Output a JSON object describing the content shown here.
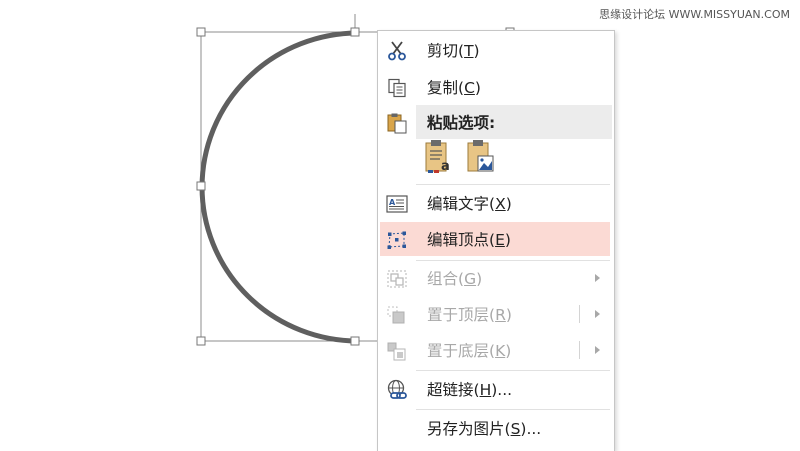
{
  "watermark": "思缘设计论坛 WWW.MISSYUAN.COM",
  "menu": {
    "items": [
      {
        "label_pre": "剪切(",
        "key": "T",
        "label_post": ")",
        "icon": "scissors-icon",
        "disabled": false
      },
      {
        "label_pre": "复制(",
        "key": "C",
        "label_post": ")",
        "icon": "copy-icon",
        "disabled": false
      },
      {
        "label": "粘贴选项:",
        "icon": "paste-icon"
      },
      {
        "label_pre": "编辑文字(",
        "key": "X",
        "label_post": ")",
        "icon": "edit-text-icon",
        "disabled": false
      },
      {
        "label_pre": "编辑顶点(",
        "key": "E",
        "label_post": ")",
        "icon": "edit-points-icon",
        "disabled": false,
        "highlighted": true
      },
      {
        "label_pre": "组合(",
        "key": "G",
        "label_post": ")",
        "icon": "group-icon",
        "disabled": true,
        "submenu": true
      },
      {
        "label_pre": "置于顶层(",
        "key": "R",
        "label_post": ")",
        "icon": "bring-to-front-icon",
        "disabled": true,
        "submenu": true
      },
      {
        "label_pre": "置于底层(",
        "key": "K",
        "label_post": ")",
        "icon": "send-to-back-icon",
        "disabled": true,
        "submenu": true
      },
      {
        "label_pre": "超链接(",
        "key": "H",
        "label_post": ")...",
        "icon": "hyperlink-icon",
        "disabled": false
      },
      {
        "label_pre": "另存为图片(",
        "key": "S",
        "label_post": ")...",
        "icon": "",
        "disabled": false
      }
    ],
    "paste_options": [
      "paste-keep-text-icon",
      "paste-as-picture-icon"
    ]
  },
  "colors": {
    "highlight": "#fbdad4",
    "section_header": "#ececec",
    "disabled_text": "#a8a8a8",
    "shape_stroke": "#5f5f5f",
    "accent_blue": "#2b579a"
  }
}
